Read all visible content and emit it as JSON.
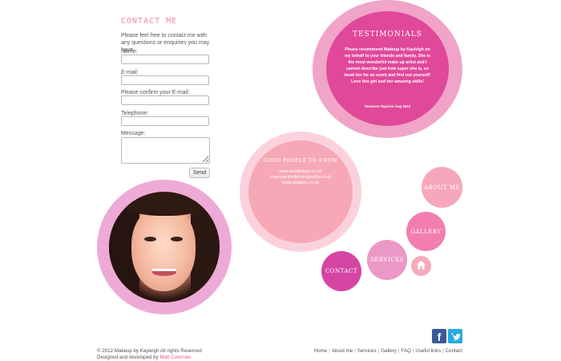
{
  "contact": {
    "title": "CONTACT ME",
    "intro": "Please feel free to contact me with any questions or enquiries you may have.",
    "fields": [
      {
        "label": "Name:"
      },
      {
        "label": "E-mail:"
      },
      {
        "label": "Please confirm your E-mail:"
      },
      {
        "label": "Telephone:"
      },
      {
        "label": "Message:"
      }
    ],
    "send_label": "Send"
  },
  "testimonials": {
    "title": "TESTIMONIALS",
    "text": "Please recommend Makeup by Kayleigh on my behalf to your friends and family. She is the most wonderful make up artist and I cannot describe just how super she is, so book her for an event and find out yourself! Love this girl and her amazing skills!",
    "author": "Susanna Squires Aug 2012"
  },
  "good_people": {
    "title": "GOOD PEOPLE TO KNOW",
    "links": [
      "www.amplydays.co.uk",
      "www.alanfordphotography.co.uk",
      "www.andisdo.co.uk"
    ]
  },
  "nav": {
    "about": "ABOUT ME",
    "gallery": "GALLERY",
    "services": "SERVICES",
    "contact": "CONTACT",
    "home_icon": "home-icon"
  },
  "social": {
    "facebook_icon": "facebook-icon",
    "twitter_icon": "twitter-icon"
  },
  "footer": {
    "copyright": "© 2012 Makeup by Kayleigh All rights Reserved",
    "credit_prefix": "Designed and developed by ",
    "credit_name": "Matt Coleman",
    "links": [
      "Home",
      "About me",
      "Services",
      "Gallery",
      "FAQ",
      "Useful links",
      "Contact"
    ]
  },
  "colors": {
    "accent_pink": "#e0489a",
    "light_pink": "#f0a4c8",
    "title_pink": "#f08aa8"
  }
}
